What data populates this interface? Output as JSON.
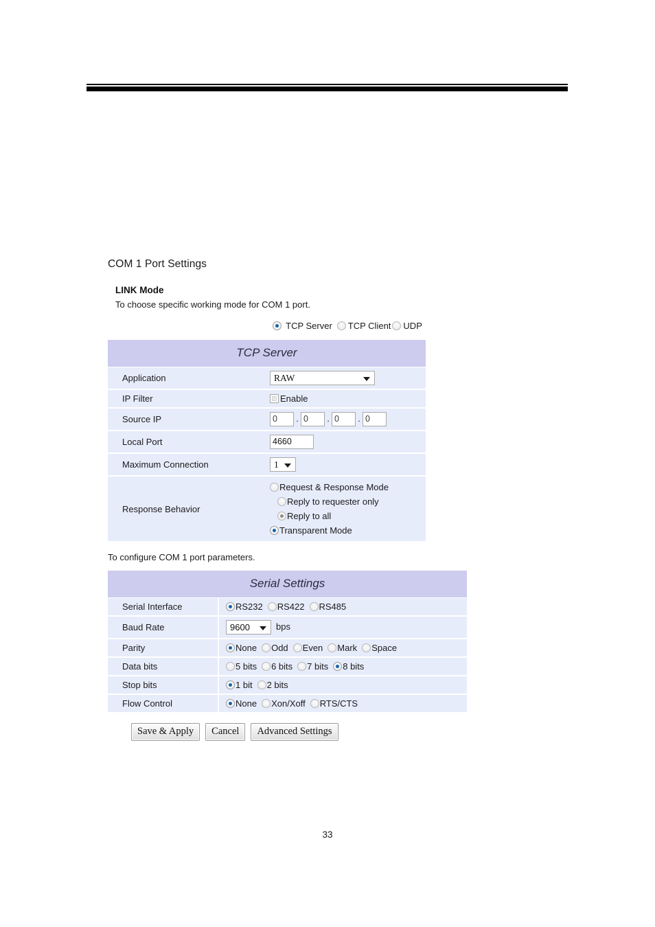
{
  "page": {
    "number": "33"
  },
  "section": {
    "title": "COM 1 Port Settings"
  },
  "link_mode": {
    "heading": "LINK Mode",
    "description": "To choose specific working mode for COM 1 port.",
    "options": [
      {
        "label": "TCP Server",
        "selected": true
      },
      {
        "label": "TCP Client",
        "selected": false
      },
      {
        "label": "UDP",
        "selected": false
      }
    ]
  },
  "tcp_server": {
    "title": "TCP Server",
    "rows": {
      "application": {
        "label": "Application",
        "value": "RAW"
      },
      "ip_filter": {
        "label": "IP Filter",
        "checkbox_label": "Enable",
        "checked": false
      },
      "source_ip": {
        "label": "Source IP",
        "octets": [
          "0",
          "0",
          "0",
          "0"
        ],
        "separator": "."
      },
      "local_port": {
        "label": "Local Port",
        "value": "4660"
      },
      "maximum_connection": {
        "label": "Maximum Connection",
        "value": "1"
      },
      "response_behavior": {
        "label": "Response Behavior",
        "options": [
          {
            "label": "Request & Response Mode",
            "selected": false,
            "indent": 0
          },
          {
            "label": "Reply to requester only",
            "selected": false,
            "indent": 1
          },
          {
            "label": "Reply to all",
            "selected": true,
            "disabled": true,
            "indent": 1
          },
          {
            "label": "Transparent Mode",
            "selected": true,
            "indent": 0
          }
        ]
      }
    }
  },
  "serial": {
    "description": "To configure COM 1 port parameters.",
    "title": "Serial Settings",
    "rows": {
      "serial_interface": {
        "label": "Serial Interface",
        "options": [
          {
            "label": "RS232",
            "selected": true
          },
          {
            "label": "RS422",
            "selected": false
          },
          {
            "label": "RS485",
            "selected": false
          }
        ]
      },
      "baud_rate": {
        "label": "Baud Rate",
        "value": "9600",
        "unit": "bps"
      },
      "parity": {
        "label": "Parity",
        "options": [
          {
            "label": "None",
            "selected": true
          },
          {
            "label": "Odd",
            "selected": false
          },
          {
            "label": "Even",
            "selected": false
          },
          {
            "label": "Mark",
            "selected": false
          },
          {
            "label": "Space",
            "selected": false
          }
        ]
      },
      "data_bits": {
        "label": "Data bits",
        "options": [
          {
            "label": "5 bits",
            "selected": false
          },
          {
            "label": "6 bits",
            "selected": false
          },
          {
            "label": "7 bits",
            "selected": false
          },
          {
            "label": "8 bits",
            "selected": true
          }
        ]
      },
      "stop_bits": {
        "label": "Stop bits",
        "options": [
          {
            "label": "1 bit",
            "selected": true
          },
          {
            "label": "2 bits",
            "selected": false
          }
        ]
      },
      "flow_control": {
        "label": "Flow Control",
        "options": [
          {
            "label": "None",
            "selected": true
          },
          {
            "label": "Xon/Xoff",
            "selected": false
          },
          {
            "label": "RTS/CTS",
            "selected": false
          }
        ]
      }
    }
  },
  "buttons": {
    "save_apply": "Save & Apply",
    "cancel": "Cancel",
    "advanced": "Advanced Settings"
  },
  "colors": {
    "panel_header": "#cdcbee",
    "panel_row": "#e7ecfb",
    "radio_selected": "#1464aa",
    "radio_disabled_selected": "#8e8e8e"
  }
}
